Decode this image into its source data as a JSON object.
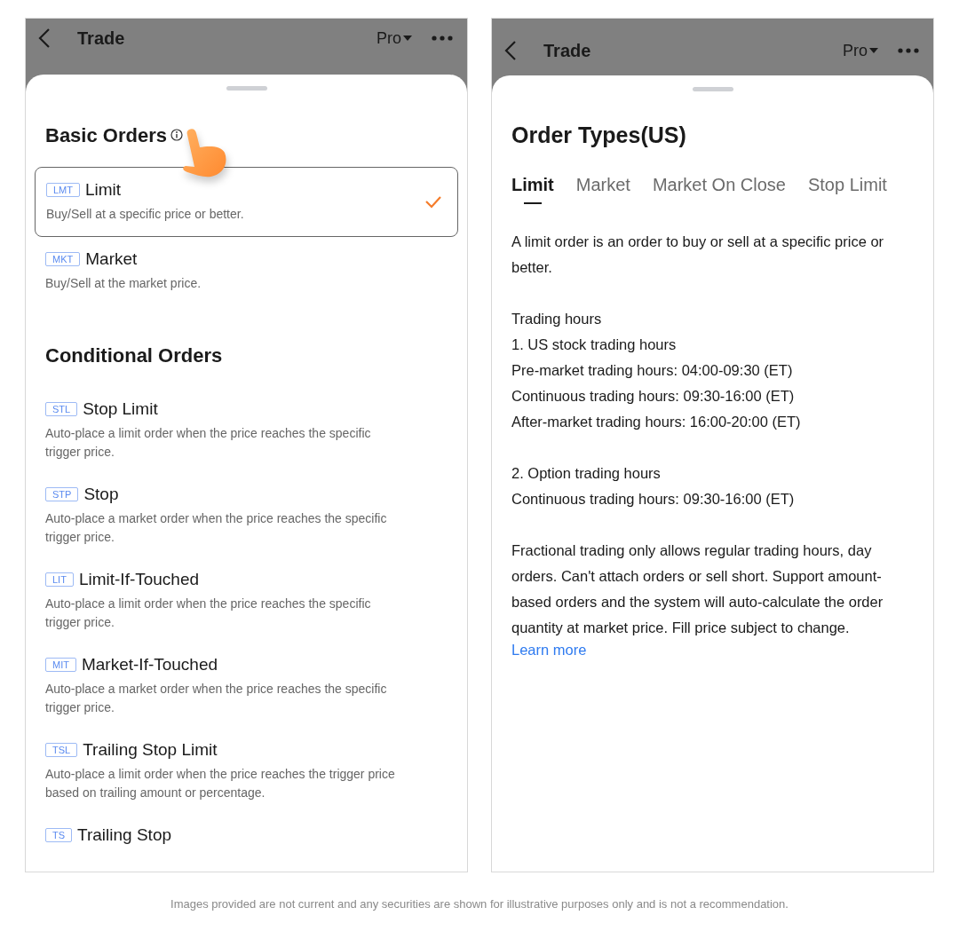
{
  "screens": [
    {
      "kind": "order_list",
      "header": {
        "title": "Trade",
        "mode": "Pro"
      },
      "sections": [
        {
          "title": "Basic Orders",
          "info": true,
          "orders": [
            {
              "tag": "LMT",
              "name": "Limit",
              "description": "Buy/Sell at a specific price or better.",
              "selected": true
            },
            {
              "tag": "MKT",
              "name": "Market",
              "description": "Buy/Sell at the market price.",
              "selected": false
            }
          ]
        },
        {
          "title": "Conditional Orders",
          "info": false,
          "orders": [
            {
              "tag": "STL",
              "name": "Stop Limit",
              "description": "Auto-place a limit order when the price reaches the specific trigger price.",
              "selected": false
            },
            {
              "tag": "STP",
              "name": "Stop",
              "description": "Auto-place a market order when the price reaches the specific trigger price.",
              "selected": false
            },
            {
              "tag": "LIT",
              "name": "Limit-If-Touched",
              "description": "Auto-place a limit order when the price reaches the specific trigger price.",
              "selected": false
            },
            {
              "tag": "MIT",
              "name": "Market-If-Touched",
              "description": "Auto-place a market order when the price reaches the specific trigger price.",
              "selected": false
            },
            {
              "tag": "TSL",
              "name": "Trailing Stop Limit",
              "description": "Auto-place a limit order when the price reaches the trigger price based on trailing amount or percentage.",
              "selected": false
            },
            {
              "tag": "TS",
              "name": "Trailing Stop",
              "selected": false
            }
          ]
        }
      ]
    },
    {
      "kind": "order_info",
      "header": {
        "title": "Trade",
        "mode": "Pro"
      },
      "title": "Order Types(US)",
      "tabs": [
        {
          "label": "Limit",
          "selected": true
        },
        {
          "label": "Market",
          "selected": false
        },
        {
          "label": "Market On Close",
          "selected": false
        },
        {
          "label": "Stop Limit",
          "selected": false
        }
      ],
      "paragraphs": [
        {
          "lines": [
            "A limit order is an order to buy or sell at a specific price or better."
          ]
        },
        {
          "lines": [
            "Trading hours",
            "1. US stock trading hours",
            "Pre-market trading hours: 04:00-09:30 (ET)",
            "Continuous trading hours: 09:30-16:00 (ET)",
            "After-market trading hours: 16:00-20:00 (ET)"
          ]
        },
        {
          "lines": [
            "2. Option trading hours",
            "Continuous trading hours: 09:30-16:00 (ET)"
          ]
        },
        {
          "lines": [
            "Fractional trading only allows regular trading hours, day orders. Can't attach orders or sell short. Support amount-based orders and the system will auto-calculate the order quantity at market price. Fill price subject to change."
          ],
          "link": "Learn more"
        }
      ]
    }
  ],
  "disclaimer": "Images provided are not current and any securities are shown for illustrative purposes only and is not a recommendation."
}
